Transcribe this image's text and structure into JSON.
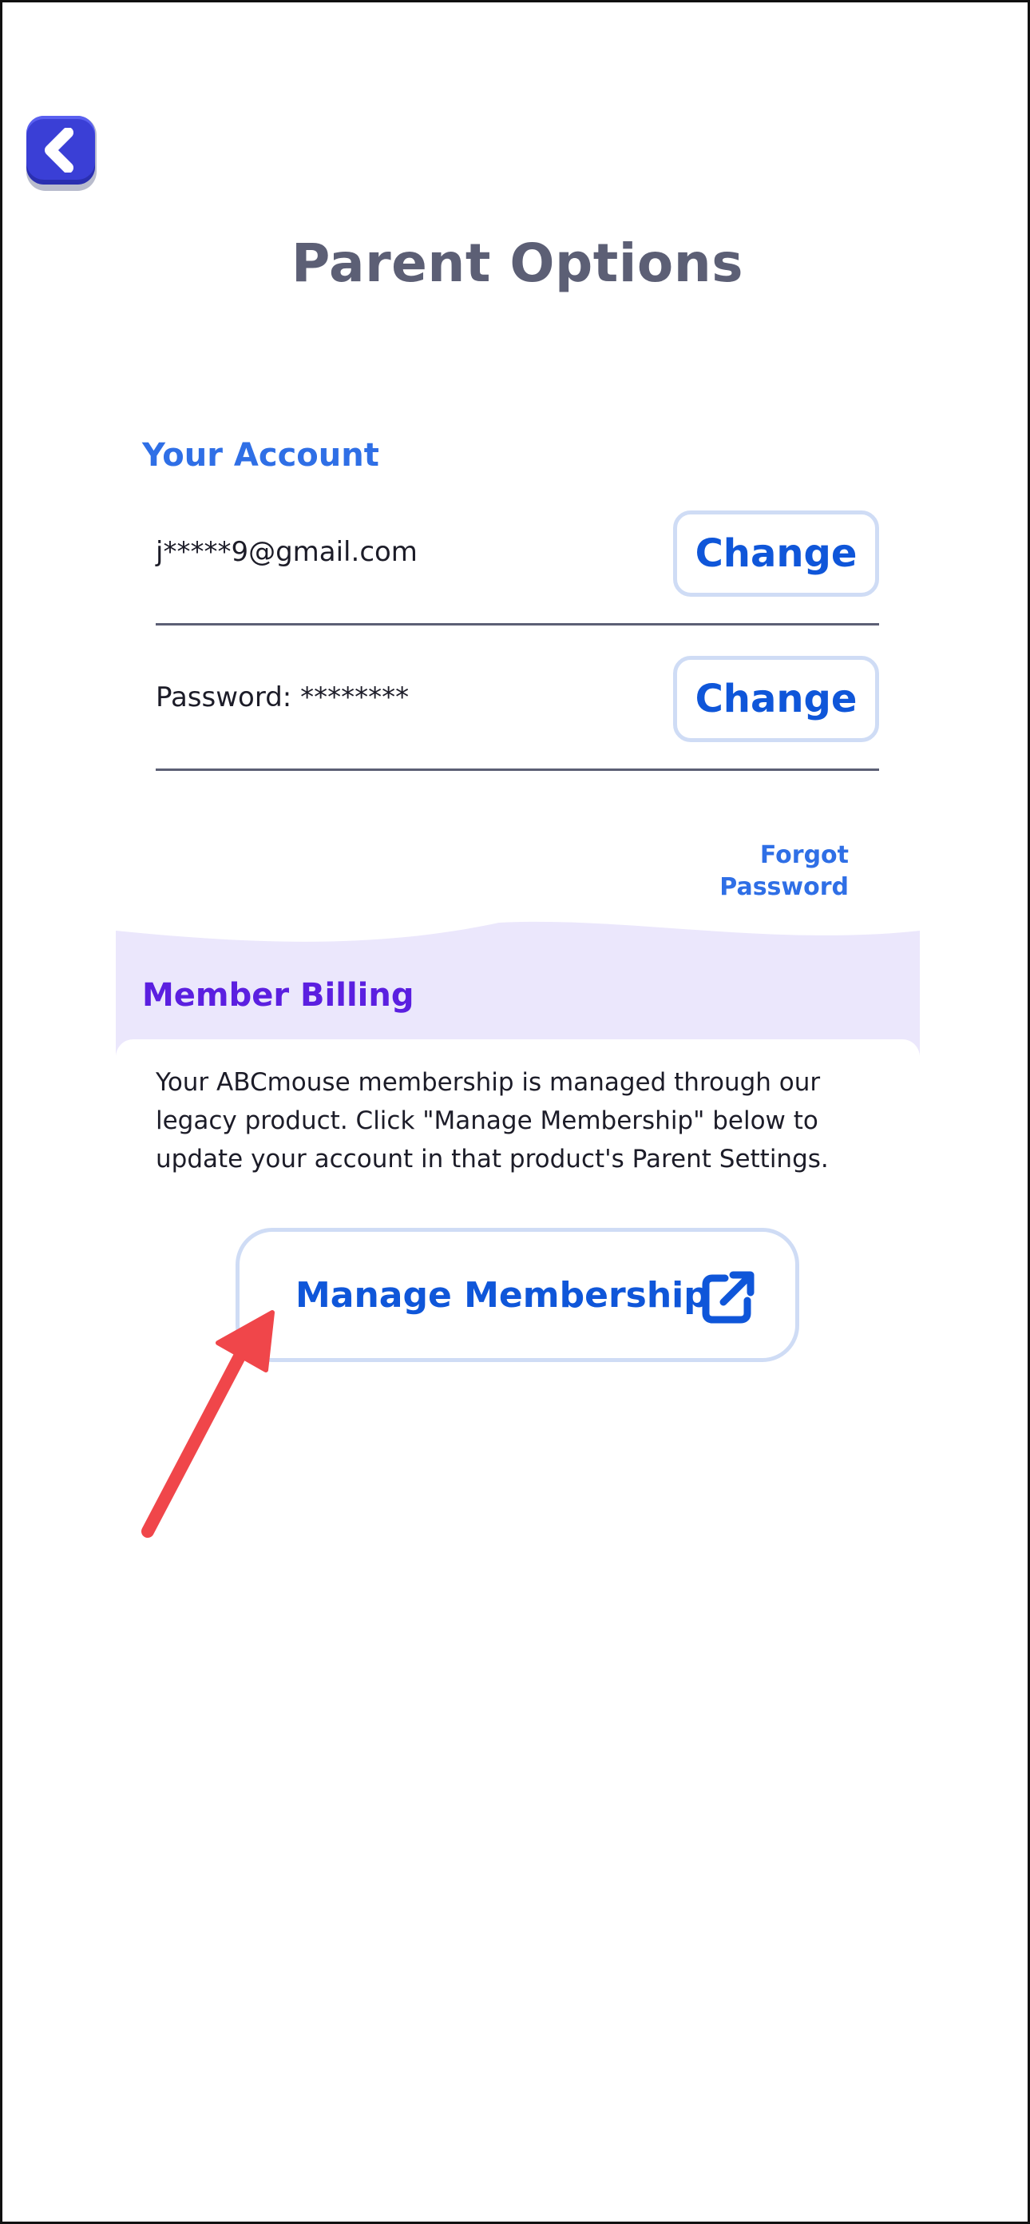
{
  "header": {
    "title": "Parent Options"
  },
  "account": {
    "section_title": "Your Account",
    "email": "j*****9@gmail.com",
    "password_text": "Password: ********",
    "change_email_label": "Change",
    "change_password_label": "Change",
    "forgot_password_label": "Forgot Password"
  },
  "billing": {
    "section_title": "Member Billing",
    "description": "Your ABCmouse membership is managed through our legacy product. Click \"Manage Membership\" below to update your account in that product's Parent Settings.",
    "manage_label": "Manage Membership"
  },
  "icons": {
    "back": "chevron-left-icon",
    "external": "external-link-icon"
  },
  "colors": {
    "accent_blue": "#0f56d9",
    "section_blue": "#2f6fe6",
    "billing_purple": "#5b1fe0",
    "billing_band": "#ebe7fc",
    "back_button": "#3a3fd6",
    "annotation_red": "#f0464a"
  }
}
